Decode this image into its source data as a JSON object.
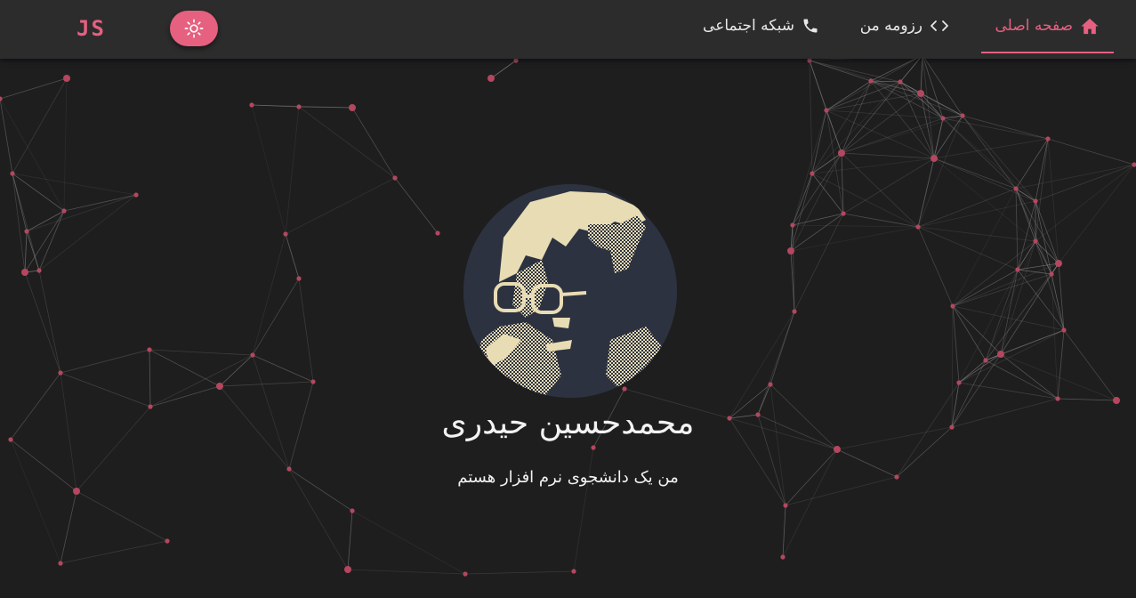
{
  "brand": {
    "logo_text": "JS"
  },
  "theme_toggle": {
    "icon": "sun-icon"
  },
  "nav": {
    "items": [
      {
        "label": "صفحه اصلی",
        "icon": "home-icon",
        "active": true
      },
      {
        "label": "رزومه من",
        "icon": "code-icon",
        "active": false
      },
      {
        "label": "شبکه اجتماعی",
        "icon": "phone-icon",
        "active": false
      }
    ]
  },
  "hero": {
    "name": "محمدحسین حیدری",
    "tagline": "من یک  دانشجوی نرم افزار هستم"
  },
  "colors": {
    "accent": "#e6607f",
    "background": "#1e1e1f",
    "navbar": "#2c2c2d",
    "text": "#e8e8e8",
    "network_line": "#8a8a8a",
    "network_node": "#b4475f"
  }
}
